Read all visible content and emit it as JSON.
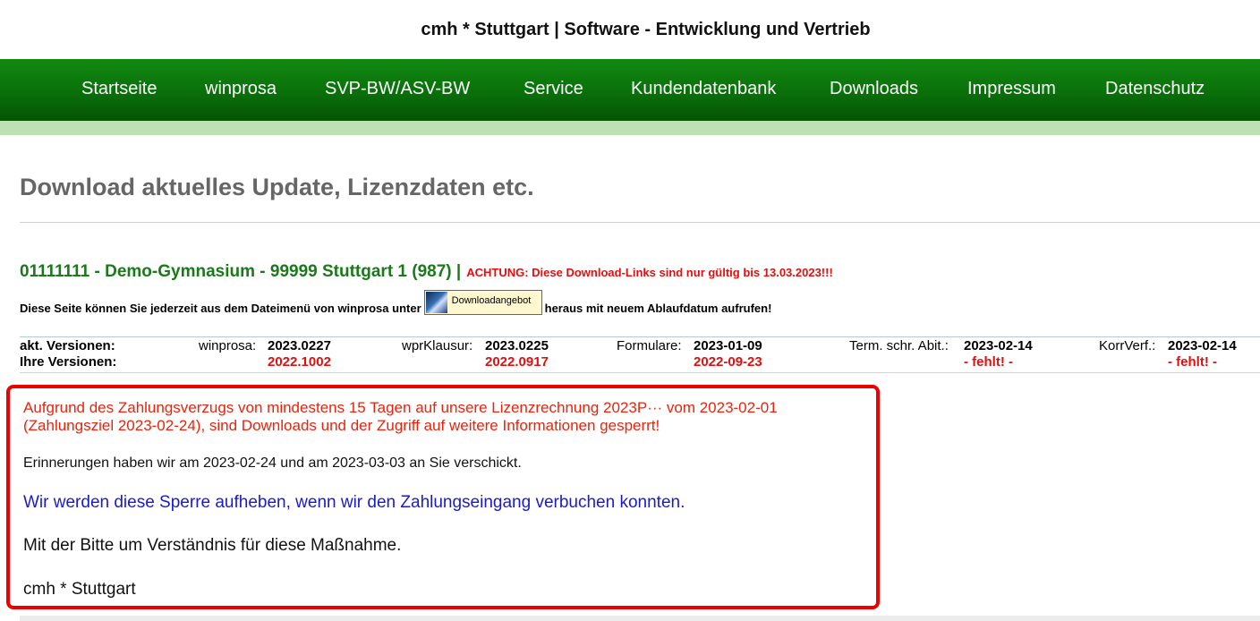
{
  "site": {
    "title": "cmh * Stuttgart | Software - Entwicklung und Vertrieb"
  },
  "nav": {
    "items": [
      {
        "label": "Startseite"
      },
      {
        "label": "winprosa"
      },
      {
        "label": "SVP-BW/ASV-BW"
      },
      {
        "label": "Service"
      },
      {
        "label": "Kundendatenbank"
      },
      {
        "label": "Downloads"
      },
      {
        "label": "Impressum"
      },
      {
        "label": "Datenschutz"
      }
    ]
  },
  "page": {
    "heading": "Download aktuelles Update, Lizenzdaten etc."
  },
  "school": {
    "name": "01111111 - Demo-Gymnasium - 99999 Stuttgart 1 (987) |",
    "warning": "ACHTUNG: Diese Download-Links sind nur gültig bis 13.03.2023!!!"
  },
  "info": {
    "before": "Diese Seite können Sie jederzeit aus dem Dateimenü von winprosa unter",
    "button_label": "Downloadangebot",
    "after": "heraus mit neuem Ablaufdatum aufrufen!"
  },
  "versions": {
    "current_label": "akt. Versionen:",
    "yours_label": "Ihre Versionen:",
    "items": [
      {
        "name": "winprosa:",
        "current": "2023.0227",
        "yours": "2022.1002"
      },
      {
        "name": "wprKlausur:",
        "current": "2023.0225",
        "yours": "2022.0917"
      },
      {
        "name": "Formulare:",
        "current": "2023-01-09",
        "yours": "2022-09-23"
      },
      {
        "name": "Term. schr. Abit.:",
        "current": "2023-02-14",
        "yours": "- fehlt! -"
      },
      {
        "name": "KorrVerf.:",
        "current": "2023-02-14",
        "yours": "- fehlt! -"
      }
    ]
  },
  "notice": {
    "line1": "Aufgrund des Zahlungsverzugs von mindestens 15 Tagen auf unsere Lizenzrechnung 2023P···   vom 2023-02-01",
    "line2": "(Zahlungsziel 2023-02-24), sind Downloads und der Zugriff auf weitere Informationen gesperrt!",
    "reminder": "Erinnerungen haben wir am 2023-02-24 und am 2023-03-03 an Sie verschickt.",
    "lift": "Wir werden diese Sperre aufheben, wenn wir den Zahlungseingang verbuchen konnten.",
    "please": "Mit der Bitte um Verständnis für diese Maßnahme.",
    "signature": "cmh * Stuttgart"
  },
  "colors": {
    "nav_green": "#0a6f0a",
    "nav_strip": "#bde0b5",
    "school_green": "#1a7a1a",
    "warning_red": "#e01010",
    "notice_border": "#ee0000",
    "notice_blue": "#1a1ad0"
  }
}
